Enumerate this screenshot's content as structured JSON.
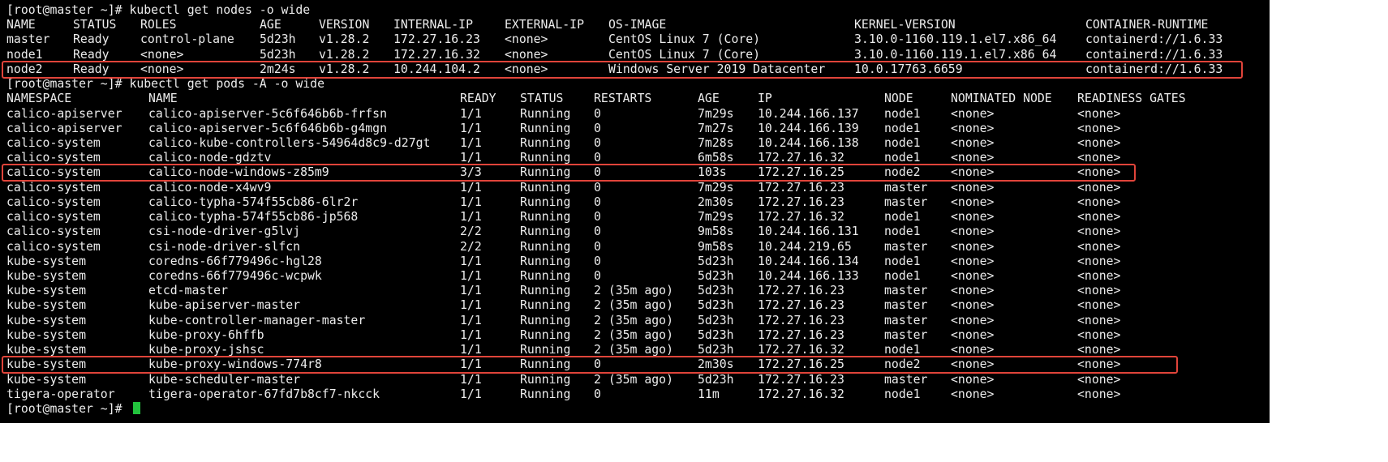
{
  "terminal": {
    "prompt_cmd1": "[root@master ~]# kubectl get nodes -o wide",
    "prompt_cmd2": "[root@master ~]# kubectl get pods -A -o wide",
    "prompt_final": "[root@master ~]# ",
    "cursor_color": "#22c33d",
    "highlight_color": "#e0443a"
  },
  "nodes_table": {
    "headers": [
      "NAME",
      "STATUS",
      "ROLES",
      "AGE",
      "VERSION",
      "INTERNAL-IP",
      "EXTERNAL-IP",
      "OS-IMAGE",
      "KERNEL-VERSION",
      "CONTAINER-RUNTIME"
    ],
    "rows": [
      [
        "master",
        "Ready",
        "control-plane",
        "5d23h",
        "v1.28.2",
        "172.27.16.23",
        "<none>",
        "CentOS Linux 7 (Core)",
        "3.10.0-1160.119.1.el7.x86_64",
        "containerd://1.6.33"
      ],
      [
        "node1",
        "Ready",
        "<none>",
        "5d23h",
        "v1.28.2",
        "172.27.16.32",
        "<none>",
        "CentOS Linux 7 (Core)",
        "3.10.0-1160.119.1.el7.x86_64",
        "containerd://1.6.33"
      ],
      [
        "node2",
        "Ready",
        "<none>",
        "2m24s",
        "v1.28.2",
        "10.244.104.2",
        "<none>",
        "Windows Server 2019 Datacenter",
        "10.0.17763.6659",
        "containerd://1.6.33"
      ]
    ],
    "highlighted_rows": [
      2
    ]
  },
  "pods_table": {
    "headers": [
      "NAMESPACE",
      "NAME",
      "READY",
      "STATUS",
      "RESTARTS",
      "AGE",
      "IP",
      "NODE",
      "NOMINATED NODE",
      "READINESS GATES"
    ],
    "rows": [
      [
        "calico-apiserver",
        "calico-apiserver-5c6f646b6b-frfsn",
        "1/1",
        "Running",
        "0",
        "7m29s",
        "10.244.166.137",
        "node1",
        "<none>",
        "<none>"
      ],
      [
        "calico-apiserver",
        "calico-apiserver-5c6f646b6b-g4mgn",
        "1/1",
        "Running",
        "0",
        "7m27s",
        "10.244.166.139",
        "node1",
        "<none>",
        "<none>"
      ],
      [
        "calico-system",
        "calico-kube-controllers-54964d8c9-d27gt",
        "1/1",
        "Running",
        "0",
        "7m28s",
        "10.244.166.138",
        "node1",
        "<none>",
        "<none>"
      ],
      [
        "calico-system",
        "calico-node-gdztv",
        "1/1",
        "Running",
        "0",
        "6m58s",
        "172.27.16.32",
        "node1",
        "<none>",
        "<none>"
      ],
      [
        "calico-system",
        "calico-node-windows-z85m9",
        "3/3",
        "Running",
        "0",
        "103s",
        "172.27.16.25",
        "node2",
        "<none>",
        "<none>"
      ],
      [
        "calico-system",
        "calico-node-x4wv9",
        "1/1",
        "Running",
        "0",
        "7m29s",
        "172.27.16.23",
        "master",
        "<none>",
        "<none>"
      ],
      [
        "calico-system",
        "calico-typha-574f55cb86-6lr2r",
        "1/1",
        "Running",
        "0",
        "2m30s",
        "172.27.16.23",
        "master",
        "<none>",
        "<none>"
      ],
      [
        "calico-system",
        "calico-typha-574f55cb86-jp568",
        "1/1",
        "Running",
        "0",
        "7m29s",
        "172.27.16.32",
        "node1",
        "<none>",
        "<none>"
      ],
      [
        "calico-system",
        "csi-node-driver-g5lvj",
        "2/2",
        "Running",
        "0",
        "9m58s",
        "10.244.166.131",
        "node1",
        "<none>",
        "<none>"
      ],
      [
        "calico-system",
        "csi-node-driver-slfcn",
        "2/2",
        "Running",
        "0",
        "9m58s",
        "10.244.219.65",
        "master",
        "<none>",
        "<none>"
      ],
      [
        "kube-system",
        "coredns-66f779496c-hgl28",
        "1/1",
        "Running",
        "0",
        "5d23h",
        "10.244.166.134",
        "node1",
        "<none>",
        "<none>"
      ],
      [
        "kube-system",
        "coredns-66f779496c-wcpwk",
        "1/1",
        "Running",
        "0",
        "5d23h",
        "10.244.166.133",
        "node1",
        "<none>",
        "<none>"
      ],
      [
        "kube-system",
        "etcd-master",
        "1/1",
        "Running",
        "2 (35m ago)",
        "5d23h",
        "172.27.16.23",
        "master",
        "<none>",
        "<none>"
      ],
      [
        "kube-system",
        "kube-apiserver-master",
        "1/1",
        "Running",
        "2 (35m ago)",
        "5d23h",
        "172.27.16.23",
        "master",
        "<none>",
        "<none>"
      ],
      [
        "kube-system",
        "kube-controller-manager-master",
        "1/1",
        "Running",
        "2 (35m ago)",
        "5d23h",
        "172.27.16.23",
        "master",
        "<none>",
        "<none>"
      ],
      [
        "kube-system",
        "kube-proxy-6hffb",
        "1/1",
        "Running",
        "2 (35m ago)",
        "5d23h",
        "172.27.16.23",
        "master",
        "<none>",
        "<none>"
      ],
      [
        "kube-system",
        "kube-proxy-jshsc",
        "1/1",
        "Running",
        "2 (35m ago)",
        "5d23h",
        "172.27.16.32",
        "node1",
        "<none>",
        "<none>"
      ],
      [
        "kube-system",
        "kube-proxy-windows-774r8",
        "1/1",
        "Running",
        "0",
        "2m30s",
        "172.27.16.25",
        "node2",
        "<none>",
        "<none>"
      ],
      [
        "kube-system",
        "kube-scheduler-master",
        "1/1",
        "Running",
        "2 (35m ago)",
        "5d23h",
        "172.27.16.23",
        "master",
        "<none>",
        "<none>"
      ],
      [
        "tigera-operator",
        "tigera-operator-67fd7b8cf7-nkcck",
        "1/1",
        "Running",
        "0",
        "11m",
        "172.27.16.32",
        "node1",
        "<none>",
        "<none>"
      ]
    ],
    "highlighted_rows": [
      4,
      17
    ]
  }
}
